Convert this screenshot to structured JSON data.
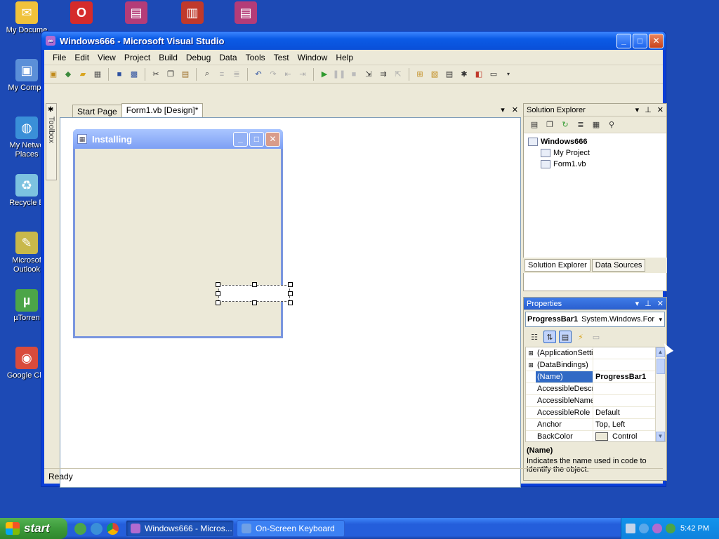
{
  "desktop": {
    "icons": [
      {
        "label": "My Docume",
        "color": "#f0c23b",
        "glyph": "✉"
      },
      {
        "label": "My Compu",
        "color": "#5b8fd8",
        "glyph": "▣"
      },
      {
        "label": "My Netwo\nPlaces",
        "color": "#3a8fd8",
        "glyph": "◍"
      },
      {
        "label": "Recycle B",
        "color": "#7cc2e0",
        "glyph": "♻"
      },
      {
        "label": "Microsof\nOutlook",
        "color": "#c8b84a",
        "glyph": "✎"
      },
      {
        "label": "µTorren",
        "color": "#4ca548",
        "glyph": "µ"
      },
      {
        "label": "Google Chr",
        "color": "#d94b3c",
        "glyph": "◉"
      }
    ],
    "top_icons": [
      {
        "name": "opera-icon",
        "color": "#d52b2b",
        "glyph": "O"
      },
      {
        "name": "winrar-icon",
        "color": "#b43c78",
        "glyph": "▤"
      },
      {
        "name": "winrar-book-icon",
        "color": "#c0392b",
        "glyph": "▥"
      },
      {
        "name": "winrar-icon-2",
        "color": "#b43c78",
        "glyph": "▤"
      }
    ]
  },
  "window": {
    "title": "Windows666 - Microsoft Visual Studio",
    "minimize": "_",
    "maximize": "□",
    "close": "✕"
  },
  "menu": [
    "File",
    "Edit",
    "View",
    "Project",
    "Build",
    "Debug",
    "Data",
    "Tools",
    "Test",
    "Window",
    "Help"
  ],
  "toolbox": {
    "label": "Toolbox"
  },
  "tabs": {
    "start_page": "Start Page",
    "form_design": "Form1.vb [Design]*",
    "dropdown": "▾",
    "close": "✕"
  },
  "form": {
    "title": "Installing",
    "min": "_",
    "max": "□",
    "close": "✕"
  },
  "solution_explorer": {
    "title": "Solution Explorer",
    "pin": "⊥",
    "close": "✕",
    "root": "Windows666",
    "items": [
      "My Project",
      "Form1.vb"
    ],
    "tab_solution": "Solution Explorer",
    "tab_data": "Data Sources"
  },
  "properties": {
    "title": "Properties",
    "object_name": "ProgressBar1",
    "object_type": "System.Windows.For",
    "rows": [
      {
        "expander": "⊞",
        "name": "(ApplicationSetti",
        "value": ""
      },
      {
        "expander": "⊞",
        "name": "(DataBindings)",
        "value": ""
      },
      {
        "expander": "",
        "name": "(Name)",
        "value": "ProgressBar1"
      },
      {
        "expander": "",
        "name": "AccessibleDescri",
        "value": ""
      },
      {
        "expander": "",
        "name": "AccessibleName",
        "value": ""
      },
      {
        "expander": "",
        "name": "AccessibleRole",
        "value": "Default"
      },
      {
        "expander": "",
        "name": "Anchor",
        "value": "Top, Left"
      },
      {
        "expander": "",
        "name": "BackColor",
        "value": "Control"
      }
    ],
    "desc_title": "(Name)",
    "desc_text": "Indicates the name used in code to identify the object."
  },
  "status": {
    "text": "Ready"
  },
  "taskbar": {
    "start": "start",
    "tasks": [
      {
        "label": "Windows666 - Micros...",
        "color": "#b06bd0",
        "active": true
      },
      {
        "label": "On-Screen Keyboard",
        "color": "#6fa0e6",
        "active": false
      }
    ],
    "clock": "5:42 PM"
  }
}
